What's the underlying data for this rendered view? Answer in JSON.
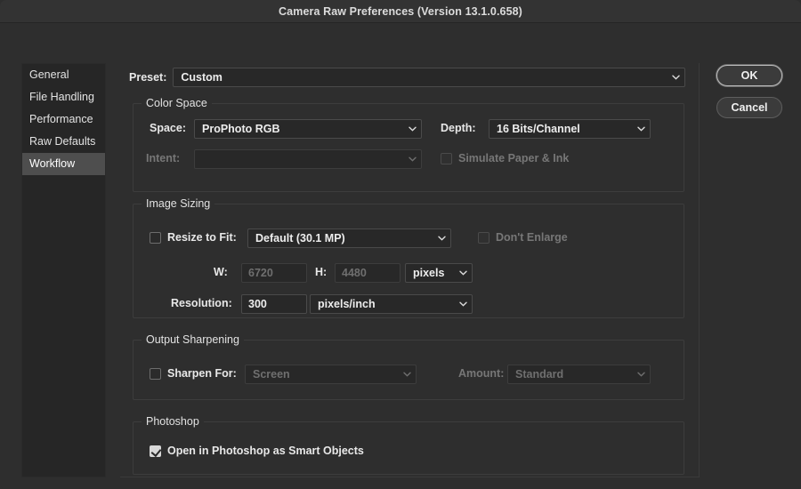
{
  "window": {
    "title": "Camera Raw Preferences  (Version 13.1.0.658)"
  },
  "sidebar": {
    "items": [
      {
        "label": "General",
        "selected": false
      },
      {
        "label": "File Handling",
        "selected": false
      },
      {
        "label": "Performance",
        "selected": false
      },
      {
        "label": "Raw Defaults",
        "selected": false
      },
      {
        "label": "Workflow",
        "selected": true
      }
    ]
  },
  "actions": {
    "ok_label": "OK",
    "cancel_label": "Cancel"
  },
  "preset": {
    "label": "Preset:",
    "value": "Custom"
  },
  "color_space": {
    "legend": "Color Space",
    "space_label": "Space:",
    "space_value": "ProPhoto RGB",
    "depth_label": "Depth:",
    "depth_value": "16 Bits/Channel",
    "intent_label": "Intent:",
    "intent_value": "",
    "simulate_label": "Simulate Paper & Ink",
    "simulate_checked": false
  },
  "image_sizing": {
    "legend": "Image Sizing",
    "resize_label": "Resize to Fit:",
    "resize_checked": false,
    "resize_value": "Default  (30.1 MP)",
    "dont_enlarge_label": "Don't Enlarge",
    "dont_enlarge_checked": false,
    "width_label": "W:",
    "width_value": "6720",
    "height_label": "H:",
    "height_value": "4480",
    "unit_value": "pixels",
    "resolution_label": "Resolution:",
    "resolution_value": "300",
    "resolution_unit_value": "pixels/inch"
  },
  "output_sharpening": {
    "legend": "Output Sharpening",
    "sharpen_label": "Sharpen For:",
    "sharpen_checked": false,
    "sharpen_value": "Screen",
    "amount_label": "Amount:",
    "amount_value": "Standard"
  },
  "photoshop": {
    "legend": "Photoshop",
    "smart_objects_label": "Open in Photoshop as Smart Objects",
    "smart_objects_checked": true
  },
  "colors": {
    "window_bg": "#2e2e2e",
    "titlebar_bg": "#333333",
    "sidebar_bg": "#262626",
    "selected_row": "#4e4e4e",
    "control_bg": "#282828",
    "text": "#e8e8e8",
    "text_disabled": "#6f6f6f"
  }
}
